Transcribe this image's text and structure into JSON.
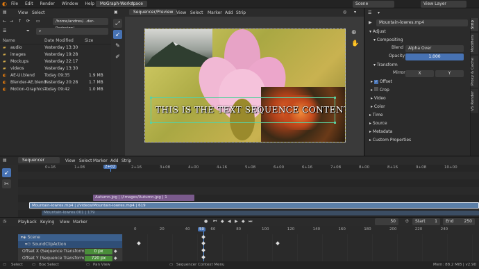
{
  "topbar": {
    "menus": [
      "File",
      "Edit",
      "Render",
      "Window",
      "Help"
    ],
    "workspace_tab": "MoGraph-Workspace",
    "scene": "Scene",
    "view_layer": "View Layer"
  },
  "filebrowser": {
    "menus": [
      "View",
      "Select"
    ],
    "path": "/home/andres/...der-Redesign/",
    "columns": {
      "name": "Name",
      "date": "Date Modified",
      "size": "Size"
    },
    "files": [
      {
        "name": "audio",
        "date": "Yesterday 13:30",
        "size": "",
        "icon": "folder-icon"
      },
      {
        "name": "images",
        "date": "Yesterday 19:28",
        "size": "",
        "icon": "folder-icon"
      },
      {
        "name": "Mockups",
        "date": "Yesterday 22:17",
        "size": "",
        "icon": "folder-icon"
      },
      {
        "name": "videos",
        "date": "Yesterday 13:30",
        "size": "",
        "icon": "folder-icon"
      },
      {
        "name": "AE-UI.blend",
        "date": "Today 09:35",
        "size": "1.9 MB",
        "icon": "blend-icon"
      },
      {
        "name": "Blender-AE.blend",
        "date": "Yesterday 20:28",
        "size": "1.7 MB",
        "icon": "blend-icon"
      },
      {
        "name": "Motion-Graphics-...",
        "date": "Today 09:42",
        "size": "1.0 MB",
        "icon": "blend-icon"
      }
    ]
  },
  "preview": {
    "editor": "Sequencer/Preview",
    "menus": [
      "View",
      "Select",
      "Marker",
      "Add",
      "Strip"
    ],
    "overlay_text": "THIS IS THE TEXT SEQUENCE CONTENT"
  },
  "properties": {
    "strip_name": "Mountain-lowres.mp4",
    "adjust": "Adjust",
    "compositing": "Compositing",
    "blend_label": "Blend",
    "blend_value": "Alpha Over",
    "opacity_label": "Opacity",
    "opacity_value": "1.000",
    "transform": "Transform",
    "mirror_label": "Mirror",
    "mirror_x": "X",
    "mirror_y": "Y",
    "offset": "Offset",
    "crop": "Crop",
    "video": "Video",
    "color": "Color",
    "time": "Time",
    "source": "Source",
    "metadata": "Metadata",
    "custom": "Custom Properties",
    "vtabs": [
      "Strip",
      "Modifiers",
      "Proxy & Cache",
      "VS Render"
    ]
  },
  "sequencer": {
    "editor": "Sequencer",
    "menus": [
      "View",
      "Select",
      "Marker",
      "Add",
      "Strip"
    ],
    "current": "2+02",
    "ticks": [
      "0+16",
      "1+08",
      "1+16",
      "2+16",
      "3+08",
      "4+00",
      "4+16",
      "5+08",
      "6+00",
      "6+16",
      "7+08",
      "8+00",
      "8+16",
      "9+08",
      "10+00"
    ],
    "strips": [
      {
        "label": "Autumn.jpg | //images/Autumn.jpg | 1",
        "color": "#7a5a8c"
      },
      {
        "label": "Mountain-lowres.mp4 | //videos/Mountain-lowres.mp4 | 619",
        "color": "#5b7fa8"
      },
      {
        "label": "Mountain-lowres.001 | 179",
        "color": "#3b4d63"
      }
    ]
  },
  "timeline": {
    "menus": [
      "Playback",
      "Keying",
      "View",
      "Marker"
    ],
    "current": "50",
    "start_label": "Start",
    "start": "1",
    "end_label": "End",
    "end": "250",
    "ticks": [
      "0",
      "20",
      "40",
      "50",
      "60",
      "80",
      "100",
      "120",
      "140",
      "160",
      "180",
      "200",
      "220",
      "240"
    ],
    "channels": [
      {
        "name": "Scene"
      },
      {
        "name": "SoundClipAction"
      },
      {
        "name": "Offset X (Sequence Transform)",
        "value": "0 px"
      },
      {
        "name": "Offset Y (Sequence Transform)",
        "value": "720 px"
      }
    ]
  },
  "status": {
    "select": "Select",
    "box": "Box Select",
    "pan": "Pan View",
    "context": "Sequencer Context Menu",
    "memory": "Mem: 88.2 MiB | v2.90"
  }
}
